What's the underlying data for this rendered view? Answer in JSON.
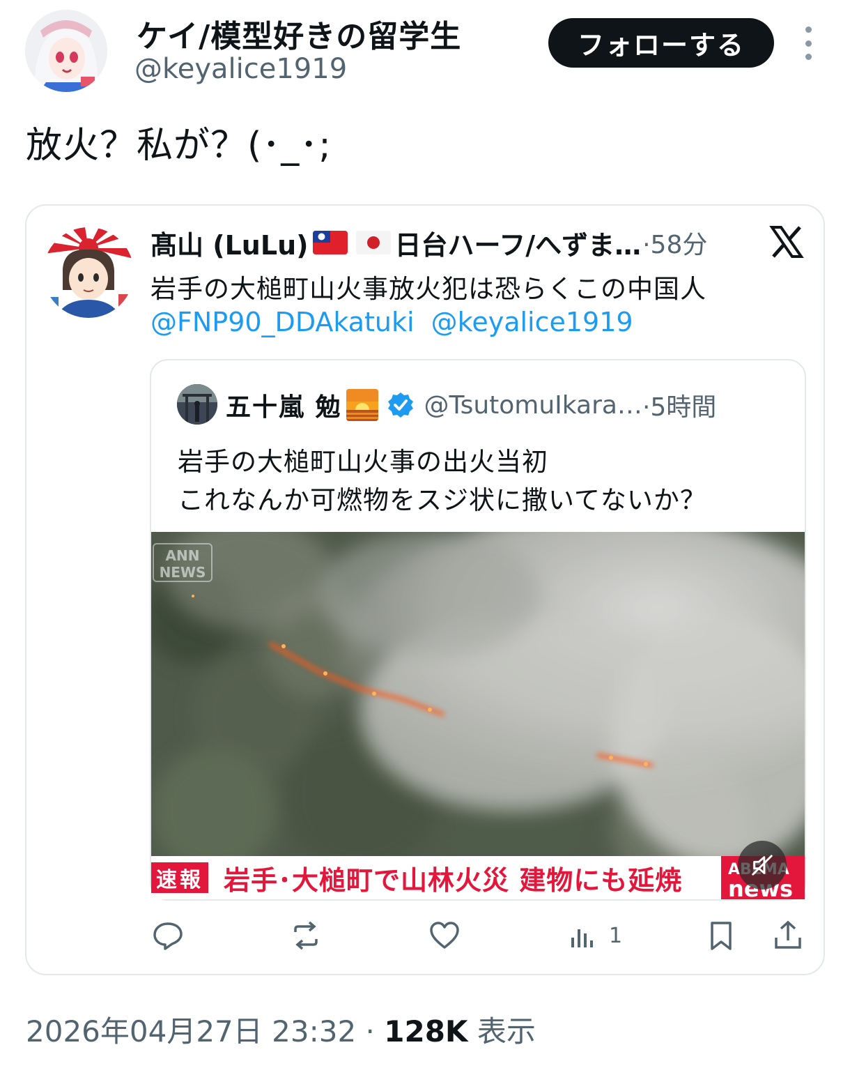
{
  "tweet": {
    "display_name": "ケイ/模型好きの留学生",
    "handle": "@keyalice1919",
    "follow_label": "フォローする",
    "text": "放火？私が？(･_･;",
    "timestamp": "2026年04月27日 23:32",
    "separator": "·",
    "views_count": "128K",
    "views_label": "表示"
  },
  "quote": {
    "display_name": "髙山 (LuLu)",
    "name_suffix": "日台ハーフ/へずま…",
    "time": "·58分",
    "text": "岩手の大槌町山火事放火犯は恐らくこの中国人",
    "mentions": [
      "@FNP90_DDAkatuki",
      "@keyalice1919"
    ],
    "actions": {
      "views_count": "1"
    }
  },
  "inner_quote": {
    "display_name": "五十嵐 勉",
    "handle": "@TsutomuIkara…",
    "time": "·5時間",
    "text_line1": "岩手の大槌町山火事の出火当初",
    "text_line2": "これなんか可燃物をスジ状に撒いてないか？",
    "media": {
      "watermark_top": "ANN",
      "watermark_bottom": "NEWS",
      "ticker_tag": "速報",
      "ticker_text": "岩手･大槌町で山林火災 建物にも延焼",
      "brand_top": "ABEMA",
      "brand_bottom": "news"
    }
  },
  "colors": {
    "text_primary": "#0f1419",
    "text_secondary": "#536471",
    "link": "#1d9bf0",
    "border": "#e4e8eb",
    "ticker_red": "#e3163b",
    "follow_bg": "#0f1419"
  }
}
